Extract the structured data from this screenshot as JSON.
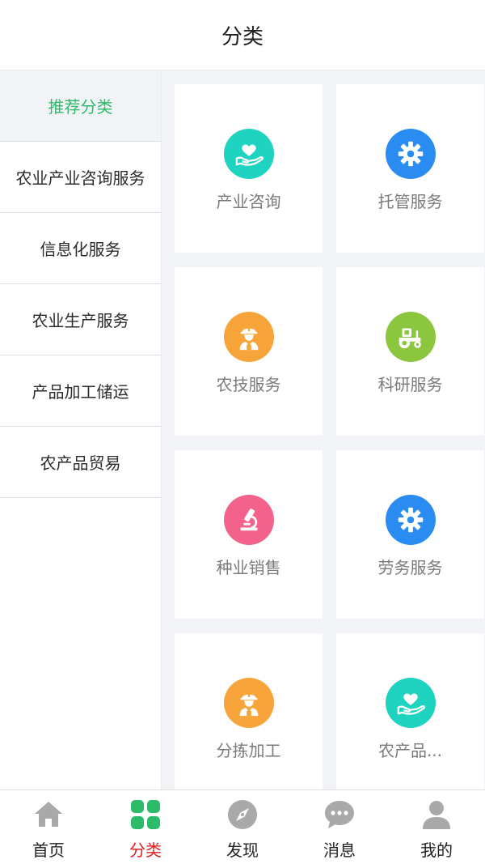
{
  "header": {
    "title": "分类"
  },
  "sidebar": {
    "items": [
      {
        "label": "推荐分类",
        "active": true
      },
      {
        "label": "农业产业咨询服务",
        "active": false
      },
      {
        "label": "信息化服务",
        "active": false
      },
      {
        "label": "农业生产服务",
        "active": false
      },
      {
        "label": "产品加工储运",
        "active": false
      },
      {
        "label": "农产品贸易",
        "active": false
      }
    ]
  },
  "grid": {
    "cards": [
      {
        "label": "产业咨询",
        "icon": "heart-hand-icon",
        "color": "#1ed3bf"
      },
      {
        "label": "托管服务",
        "icon": "gear-icon",
        "color": "#2a8cf0"
      },
      {
        "label": "农技服务",
        "icon": "worker-icon",
        "color": "#f7a43a"
      },
      {
        "label": "科研服务",
        "icon": "tractor-icon",
        "color": "#8cc63f"
      },
      {
        "label": "种业销售",
        "icon": "microscope-icon",
        "color": "#f2628a"
      },
      {
        "label": "劳务服务",
        "icon": "gear-icon",
        "color": "#2a8cf0"
      },
      {
        "label": "分拣加工",
        "icon": "worker-icon",
        "color": "#f7a43a"
      },
      {
        "label": "农产品...",
        "icon": "heart-hand-icon",
        "color": "#1ed3bf"
      }
    ]
  },
  "tabbar": {
    "tabs": [
      {
        "label": "首页",
        "icon": "home-icon",
        "active": false
      },
      {
        "label": "分类",
        "icon": "category-grid-icon",
        "active": true
      },
      {
        "label": "发现",
        "icon": "compass-icon",
        "active": false
      },
      {
        "label": "消息",
        "icon": "message-icon",
        "active": false
      },
      {
        "label": "我的",
        "icon": "user-icon",
        "active": false
      }
    ]
  },
  "colors": {
    "accent_green": "#2dbb6a",
    "active_tab_red": "#e02020",
    "background_gray": "#f1f3f6"
  }
}
